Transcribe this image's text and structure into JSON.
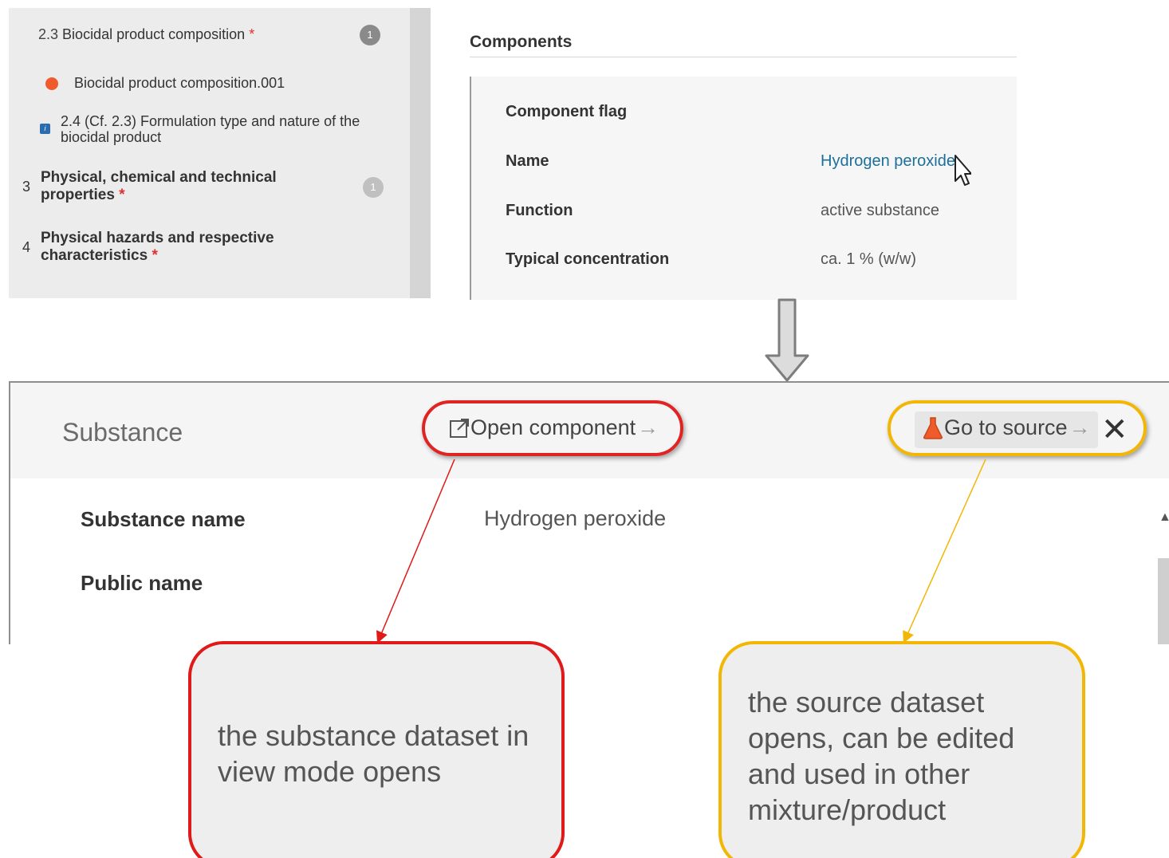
{
  "nav_tree": {
    "items": [
      {
        "number": "2.3",
        "label": "Biocidal product composition",
        "required": "*",
        "count": "1"
      },
      {
        "label": "Biocidal product composition.001",
        "icon": "status-dot-icon"
      },
      {
        "label_line1": "2.4 (Cf. 2.3) Formulation type and nature of the",
        "label_line2": "biocidal product",
        "icon": "info-icon"
      },
      {
        "number": "3",
        "label_line1": "Physical, chemical and technical",
        "label_line2": "properties",
        "required": "*",
        "count": "1"
      },
      {
        "number": "4",
        "label_line1": "Physical hazards and respective",
        "label_line2": "characteristics",
        "required": "*"
      }
    ]
  },
  "components": {
    "heading": "Components",
    "rows": [
      {
        "label": "Component flag",
        "value": ""
      },
      {
        "label": "Name",
        "value": "Hydrogen peroxide"
      },
      {
        "label": "Function",
        "value": "active substance"
      },
      {
        "label": "Typical concentration",
        "value": "ca. 1 % (w/w)"
      }
    ]
  },
  "substance_panel": {
    "title": "Substance",
    "open_component_label": "Open component",
    "go_to_source_label": "Go to source",
    "arrow_glyph": "→",
    "close_glyph": "✕",
    "fields": [
      {
        "label": "Substance name",
        "value": "Hydrogen peroxide"
      },
      {
        "label": "Public name",
        "value": ""
      }
    ]
  },
  "callouts": {
    "red_text": "the substance dataset in view mode opens",
    "yellow_text": "the source dataset opens, can be edited and used in other mixture/product"
  },
  "colors": {
    "highlight_red": "#e02424",
    "highlight_yellow": "#f2b705",
    "link_blue": "#1d6f9a",
    "status_orange": "#ef5b2b"
  }
}
